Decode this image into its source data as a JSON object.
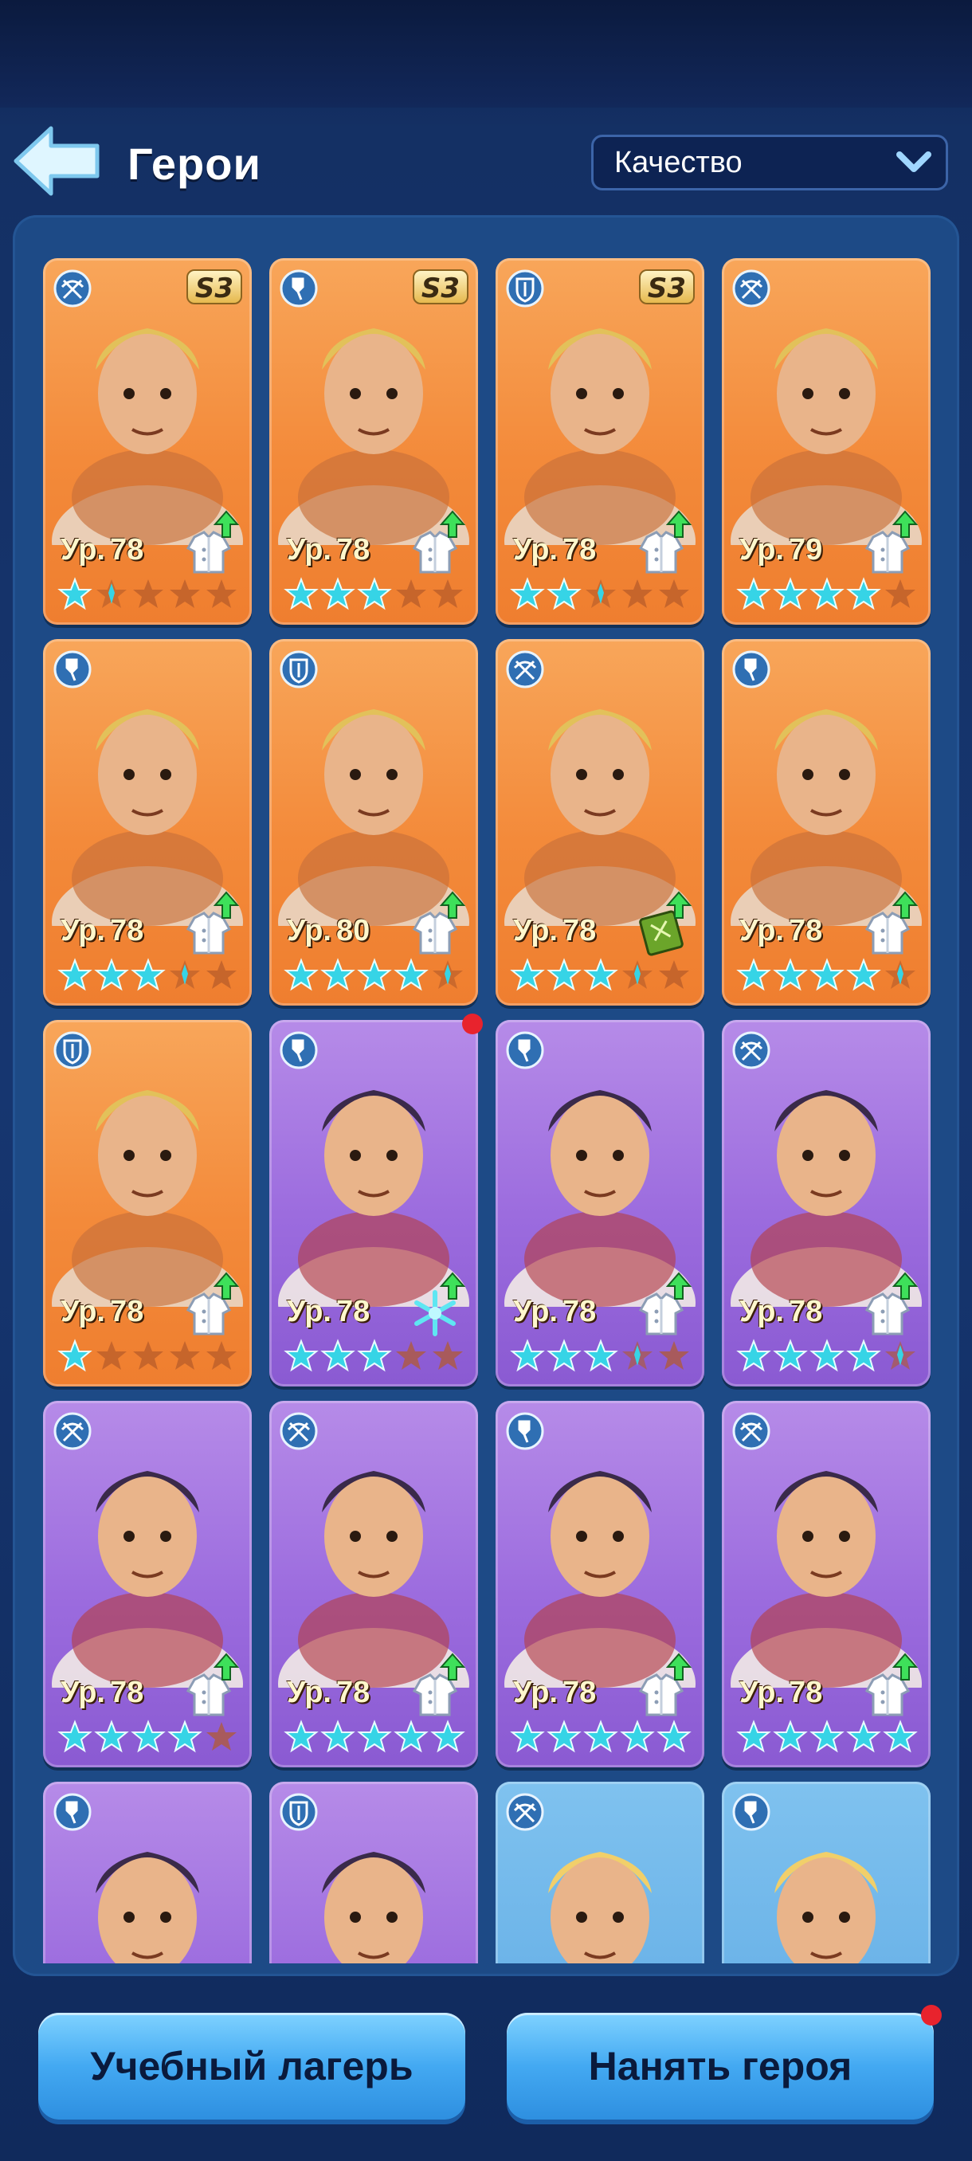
{
  "header": {
    "title": "Герои",
    "sort": {
      "selected": "Качество"
    }
  },
  "level_prefix": "Ур.",
  "heroes": [
    {
      "tier": "orange",
      "role": "crossbow",
      "season": "S3",
      "level": "78",
      "stars": [
        "full",
        "half",
        "empty",
        "empty",
        "empty"
      ],
      "gear": "coat",
      "upgrade": true
    },
    {
      "tier": "orange",
      "role": "shovel",
      "season": "S3",
      "level": "78",
      "stars": [
        "full",
        "full",
        "full",
        "empty",
        "empty"
      ],
      "gear": "coat",
      "upgrade": true
    },
    {
      "tier": "orange",
      "role": "shield",
      "season": "S3",
      "level": "78",
      "stars": [
        "full",
        "full",
        "half",
        "empty",
        "empty"
      ],
      "gear": "coat",
      "upgrade": true
    },
    {
      "tier": "orange",
      "role": "crossbow",
      "season": "",
      "level": "79",
      "stars": [
        "full",
        "full",
        "full",
        "full",
        "empty"
      ],
      "gear": "coat",
      "upgrade": true
    },
    {
      "tier": "orange",
      "role": "shovel",
      "season": "",
      "level": "78",
      "stars": [
        "full",
        "full",
        "full",
        "half",
        "empty"
      ],
      "gear": "coat",
      "upgrade": true
    },
    {
      "tier": "orange",
      "role": "shield",
      "season": "",
      "level": "80",
      "stars": [
        "full",
        "full",
        "full",
        "full",
        "half"
      ],
      "gear": "coat",
      "upgrade": true
    },
    {
      "tier": "orange",
      "role": "crossbow",
      "season": "",
      "level": "78",
      "stars": [
        "full",
        "full",
        "full",
        "half",
        "empty"
      ],
      "gear": "book",
      "upgrade": true
    },
    {
      "tier": "orange",
      "role": "shovel",
      "season": "",
      "level": "78",
      "stars": [
        "full",
        "full",
        "full",
        "full",
        "half"
      ],
      "gear": "coat",
      "upgrade": true
    },
    {
      "tier": "orange",
      "role": "shield",
      "season": "",
      "level": "78",
      "stars": [
        "full",
        "empty",
        "empty",
        "empty",
        "empty"
      ],
      "gear": "coat",
      "upgrade": true
    },
    {
      "tier": "purple",
      "role": "shovel",
      "season": "",
      "level": "78",
      "stars": [
        "full",
        "full",
        "full",
        "empty",
        "empty"
      ],
      "gear": "snowflake",
      "upgrade": true,
      "notification": true
    },
    {
      "tier": "purple",
      "role": "shovel",
      "season": "",
      "level": "78",
      "stars": [
        "full",
        "full",
        "full",
        "half",
        "empty"
      ],
      "gear": "coat",
      "upgrade": true
    },
    {
      "tier": "purple",
      "role": "crossbow",
      "season": "",
      "level": "78",
      "stars": [
        "full",
        "full",
        "full",
        "full",
        "half"
      ],
      "gear": "coat",
      "upgrade": true
    },
    {
      "tier": "purple",
      "role": "crossbow",
      "season": "",
      "level": "78",
      "stars": [
        "full",
        "full",
        "full",
        "full",
        "empty"
      ],
      "gear": "coat",
      "upgrade": true
    },
    {
      "tier": "purple",
      "role": "crossbow",
      "season": "",
      "level": "78",
      "stars": [
        "full",
        "full",
        "full",
        "full",
        "full"
      ],
      "gear": "coat",
      "upgrade": true
    },
    {
      "tier": "purple",
      "role": "shovel",
      "season": "",
      "level": "78",
      "stars": [
        "full",
        "full",
        "full",
        "full",
        "full"
      ],
      "gear": "coat",
      "upgrade": true
    },
    {
      "tier": "purple",
      "role": "crossbow",
      "season": "",
      "level": "78",
      "stars": [
        "full",
        "full",
        "full",
        "full",
        "full"
      ],
      "gear": "coat",
      "upgrade": true
    },
    {
      "tier": "purple",
      "role": "shovel",
      "season": "",
      "level": "",
      "stars": [],
      "gear": "",
      "upgrade": false
    },
    {
      "tier": "purple",
      "role": "shield",
      "season": "",
      "level": "",
      "stars": [],
      "gear": "",
      "upgrade": false
    },
    {
      "tier": "blue",
      "role": "crossbow",
      "season": "",
      "level": "",
      "stars": [],
      "gear": "",
      "upgrade": false
    },
    {
      "tier": "blue",
      "role": "shovel",
      "season": "",
      "level": "",
      "stars": [],
      "gear": "",
      "upgrade": false
    }
  ],
  "footer": {
    "training_camp": "Учебный лагерь",
    "hire_hero": "Нанять героя",
    "hire_notification": true
  },
  "colors": {
    "star_full": "#36d4e6",
    "star_empty": "#b35a2a",
    "accent": "#43a9f2"
  }
}
